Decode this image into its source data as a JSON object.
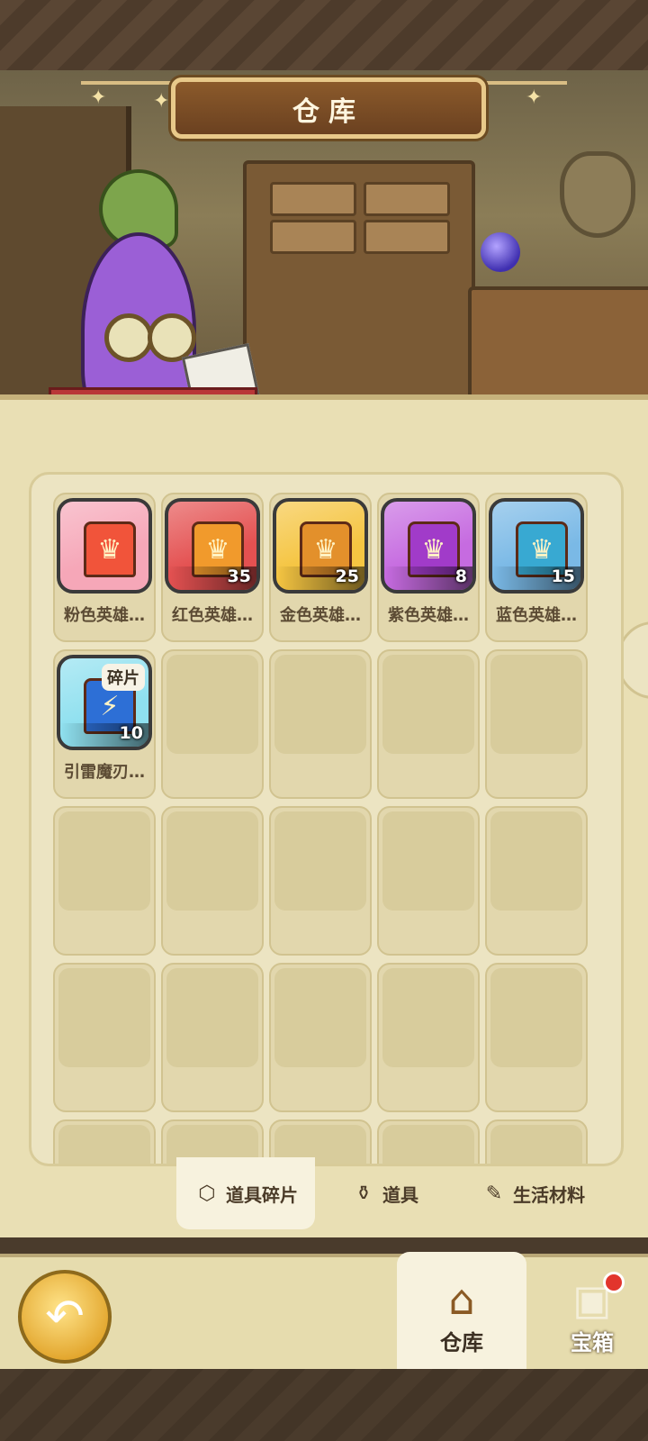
{
  "header": {
    "title": "仓库"
  },
  "items": [
    {
      "name": "粉色英雄…",
      "count": "",
      "icon": "pink-hero-emblem",
      "color": "#f6a7b8",
      "emblem_color": "#f1543a"
    },
    {
      "name": "红色英雄…",
      "count": "35",
      "icon": "red-hero-emblem",
      "color": "#e45151",
      "emblem_color": "#f19a2c"
    },
    {
      "name": "金色英雄…",
      "count": "25",
      "icon": "gold-hero-emblem",
      "color": "#f5c542",
      "emblem_color": "#e3902b"
    },
    {
      "name": "紫色英雄…",
      "count": "8",
      "icon": "purple-hero-emblem",
      "color": "#c66be0",
      "emblem_color": "#a13bc9"
    },
    {
      "name": "蓝色英雄…",
      "count": "15",
      "icon": "blue-hero-emblem",
      "color": "#7ab9e6",
      "emblem_color": "#38a9d2"
    },
    {
      "name": "引雷魔刃…",
      "count": "10",
      "tag": "碎片",
      "icon": "lightning-blade-fragment",
      "color": "#8fe0ef",
      "emblem_color": "#2d6fd6"
    }
  ],
  "tabs": [
    {
      "label": "道具碎片",
      "icon": "fragment-icon",
      "active": true
    },
    {
      "label": "道具",
      "icon": "potion-icon",
      "active": false
    },
    {
      "label": "生活材料",
      "icon": "feather-icon",
      "active": false
    }
  ],
  "nav": [
    {
      "label": "仓库",
      "icon": "warehouse-icon",
      "active": true
    },
    {
      "label": "宝箱",
      "icon": "chest-icon",
      "active": false,
      "badge": true
    }
  ]
}
